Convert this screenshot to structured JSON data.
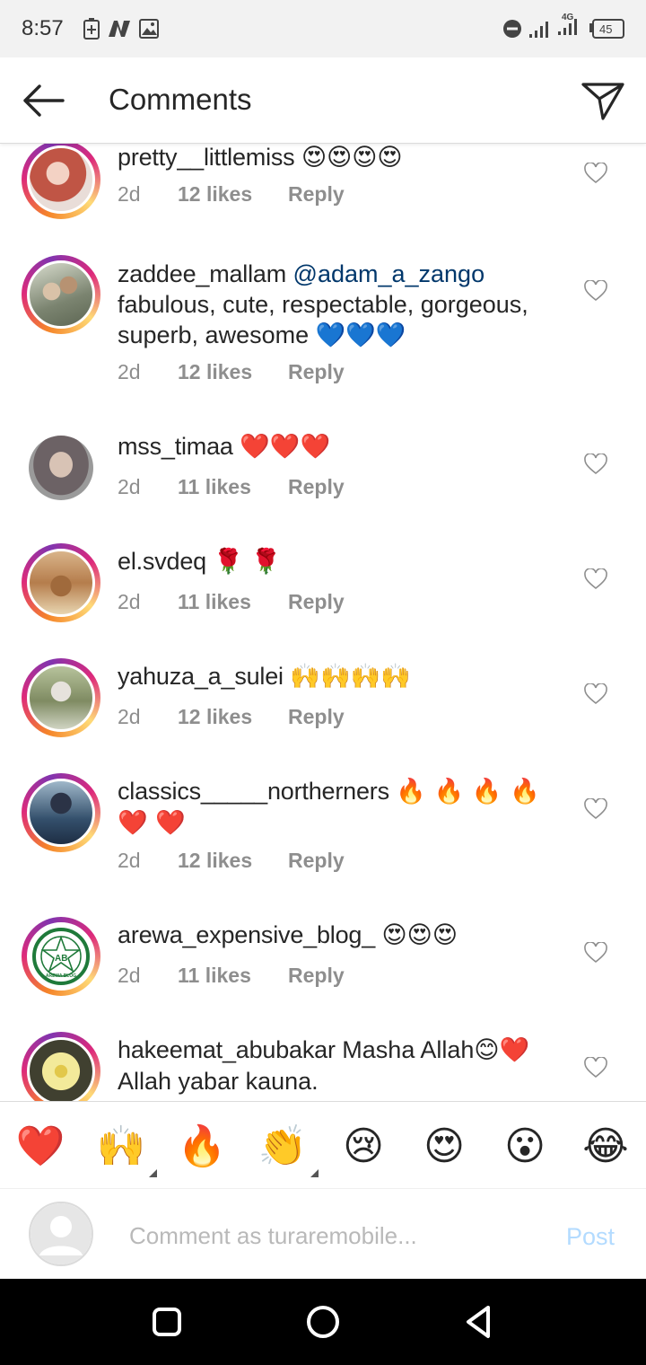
{
  "status_bar": {
    "time": "8:57",
    "network": "4G",
    "battery": "45"
  },
  "header": {
    "title": "Comments"
  },
  "comments": [
    {
      "username": "pretty__littlemiss",
      "text": "",
      "emoji": "😍😍😍😍",
      "time": "2d",
      "likes": "12 likes",
      "reply": "Reply",
      "avatar_color": "#c96a5a"
    },
    {
      "username": "zaddee_mallam",
      "mention": "@adam_a_zango",
      "text": "fabulous, cute, respectable, gorgeous, superb, awesome",
      "emoji": "💙💙💙",
      "time": "2d",
      "likes": "12 likes",
      "reply": "Reply",
      "avatar_color": "#8a8f7a"
    },
    {
      "username": "mss_timaa",
      "text": "",
      "emoji": "❤️❤️❤️",
      "time": "2d",
      "likes": "11 likes",
      "reply": "Reply",
      "avatar_color": "#6e6a6c"
    },
    {
      "username": "el.svdeq",
      "text": "",
      "emoji": "🌹 🌹",
      "time": "2d",
      "likes": "11 likes",
      "reply": "Reply",
      "avatar_color": "#a07046"
    },
    {
      "username": "yahuza_a_sulei",
      "text": "",
      "emoji": "🙌🙌🙌🙌",
      "time": "2d",
      "likes": "12 likes",
      "reply": "Reply",
      "avatar_color": "#8d9a7c"
    },
    {
      "username": "classics_____northerners",
      "text": "",
      "emoji": "🔥 🔥 🔥 🔥 ❤️ ❤️",
      "time": "2d",
      "likes": "12 likes",
      "reply": "Reply",
      "avatar_color": "#2f4a66"
    },
    {
      "username": "arewa_expensive_blog_",
      "text": "",
      "emoji": "😍😍😍",
      "time": "2d",
      "likes": "11 likes",
      "reply": "Reply",
      "avatar_color": "#1f7a3a",
      "logo_text": "AREWA BLOG"
    },
    {
      "username": "hakeemat_abubakar",
      "text": "Masha Allah",
      "text2": "Allah yabar kauna.",
      "emoji": "😊❤️",
      "avatar_color": "#d8c94a"
    }
  ],
  "reactions": [
    "❤️",
    "🙌",
    "🔥",
    "👏",
    "😢",
    "😍",
    "😮",
    "😂"
  ],
  "comment_box": {
    "placeholder": "Comment as turaremobile...",
    "post_label": "Post"
  }
}
